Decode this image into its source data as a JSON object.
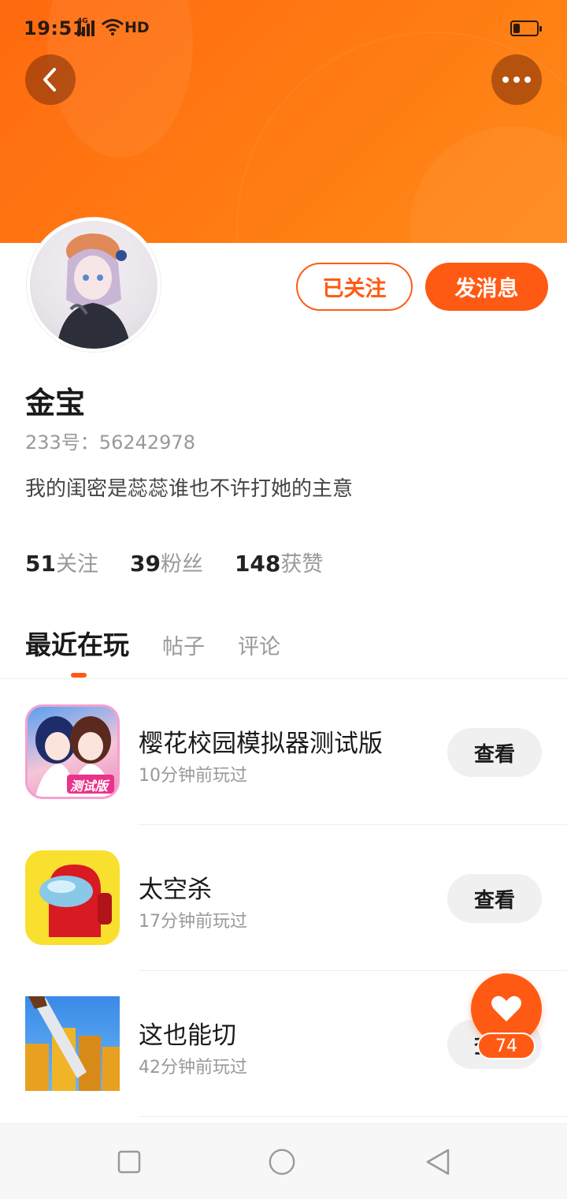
{
  "status_bar": {
    "time": "19:51",
    "network": "4G",
    "hd": "HD",
    "battery_level": 0.3
  },
  "header": {
    "back_icon": "chevron-left-icon",
    "more_icon": "more-dots-icon"
  },
  "profile": {
    "name": "金宝",
    "uid": "233号：56242978",
    "bio": "我的闺密是蕊蕊谁也不许打她的主意",
    "follow_button": "已关注",
    "message_button": "发消息",
    "stats": [
      {
        "num": "51",
        "label": "关注"
      },
      {
        "num": "39",
        "label": "粉丝"
      },
      {
        "num": "148",
        "label": "获赞"
      }
    ]
  },
  "tabs": [
    {
      "label": "最近在玩",
      "active": true
    },
    {
      "label": "帖子",
      "active": false
    },
    {
      "label": "评论",
      "active": false
    }
  ],
  "games": [
    {
      "title": "樱花校园模拟器测试版",
      "time": "10分钟前玩过",
      "button": "查看",
      "badge": "测试版"
    },
    {
      "title": "太空杀",
      "time": "17分钟前玩过",
      "button": "查看"
    },
    {
      "title": "这也能切",
      "time": "42分钟前玩过",
      "button": "查看"
    }
  ],
  "like": {
    "count": "74",
    "icon": "heart-icon"
  },
  "colors": {
    "accent": "#ff5a14",
    "banner": "#ff7a12"
  }
}
